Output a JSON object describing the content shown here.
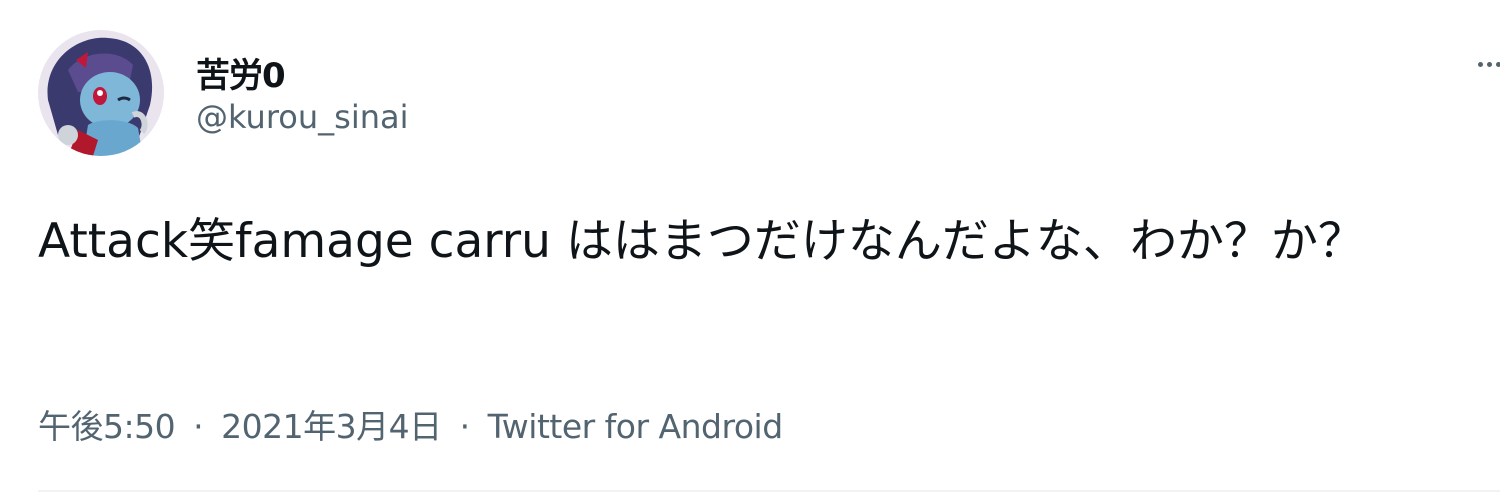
{
  "user": {
    "display_name": "苦労0",
    "handle": "@kurou_sinai"
  },
  "more_icon": "more-horizontal-icon",
  "tweet": {
    "text": "Attack笑famage carru ははまつだけなんだよな、わか？か？"
  },
  "meta": {
    "time": "午後5:50",
    "separator": "·",
    "date": "2021年3月4日",
    "source": "Twitter for Android"
  },
  "colors": {
    "text_primary": "#0f1419",
    "text_secondary": "#536471",
    "divider": "#eff3f4"
  }
}
